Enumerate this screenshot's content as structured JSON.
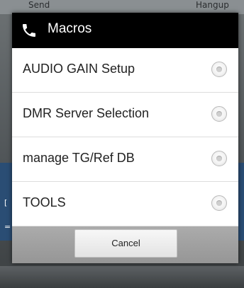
{
  "background": {
    "top_left_text": "Send",
    "top_right_text": "Hangup"
  },
  "dialog": {
    "title": "Macros",
    "icon": "phone-icon",
    "items": [
      {
        "label": "AUDIO GAIN Setup"
      },
      {
        "label": "DMR Server Selection"
      },
      {
        "label": "manage TG/Ref DB"
      },
      {
        "label": "TOOLS"
      }
    ],
    "cancel_label": "Cancel"
  },
  "colors": {
    "titlebar": "#000000",
    "list_bg": "#ffffff",
    "footer": "#a3a3a3"
  }
}
